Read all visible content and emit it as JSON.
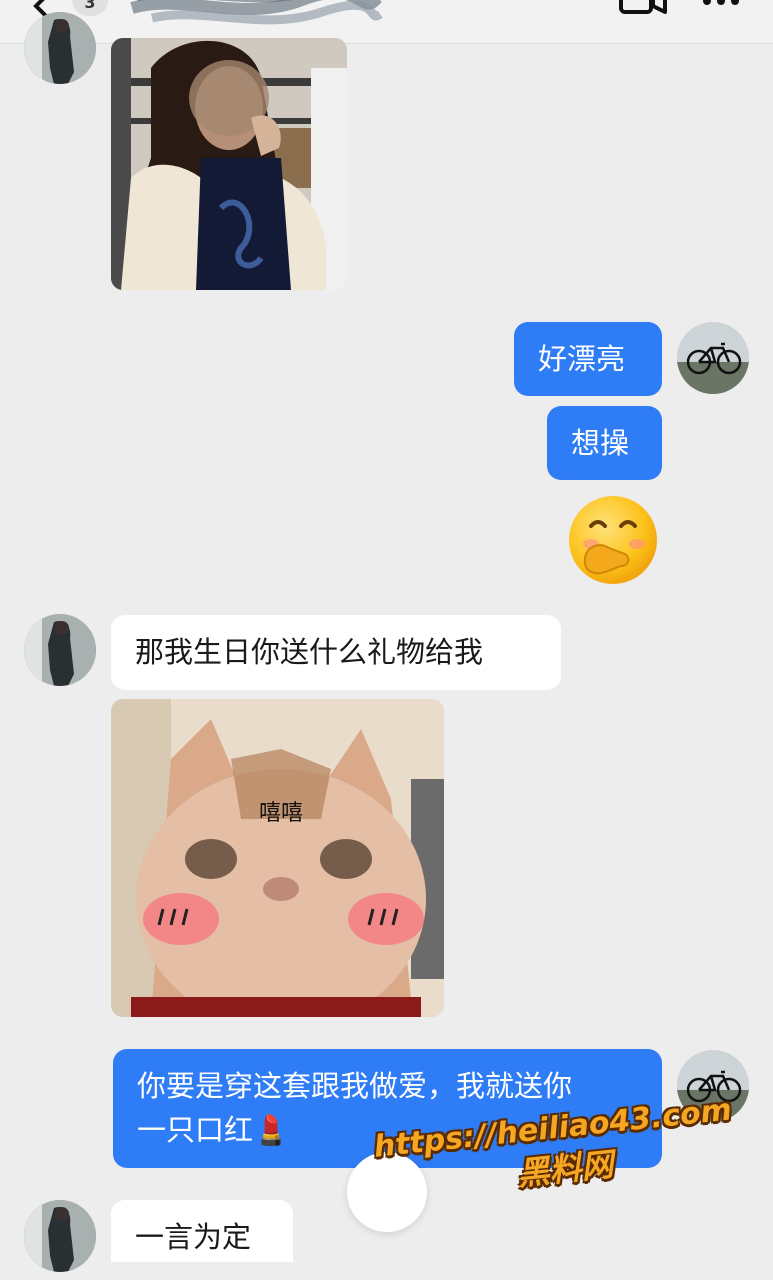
{
  "header": {
    "unread_count": "3",
    "back_icon": "chevron-left-icon",
    "video_icon": "video-call-icon",
    "more_icon": "more-dots-icon"
  },
  "messages": [
    {
      "from": "her",
      "kind": "image",
      "desc_icon": "photo-image"
    },
    {
      "from": "me",
      "kind": "text",
      "text": "好漂亮"
    },
    {
      "from": "me",
      "kind": "text",
      "text": "想操"
    },
    {
      "from": "me",
      "kind": "emoji",
      "emoji": "🤭"
    },
    {
      "from": "her",
      "kind": "text",
      "text": "那我生日你送什么礼物给我"
    },
    {
      "from": "her",
      "kind": "sticker",
      "caption": "嘻嘻"
    },
    {
      "from": "me",
      "kind": "text",
      "line1": "你要是穿这套跟我做爱，我就送你",
      "line2": "一只口红",
      "emoji": "💄"
    },
    {
      "from": "her",
      "kind": "text",
      "text": "一言为定"
    }
  ],
  "watermark": {
    "url": "https://heiliao43.com",
    "name": "黑料网"
  },
  "colors": {
    "background": "#ededed",
    "my_bubble": "#2e7cf6",
    "her_bubble": "#ffffff",
    "watermark": "#f5a623"
  }
}
